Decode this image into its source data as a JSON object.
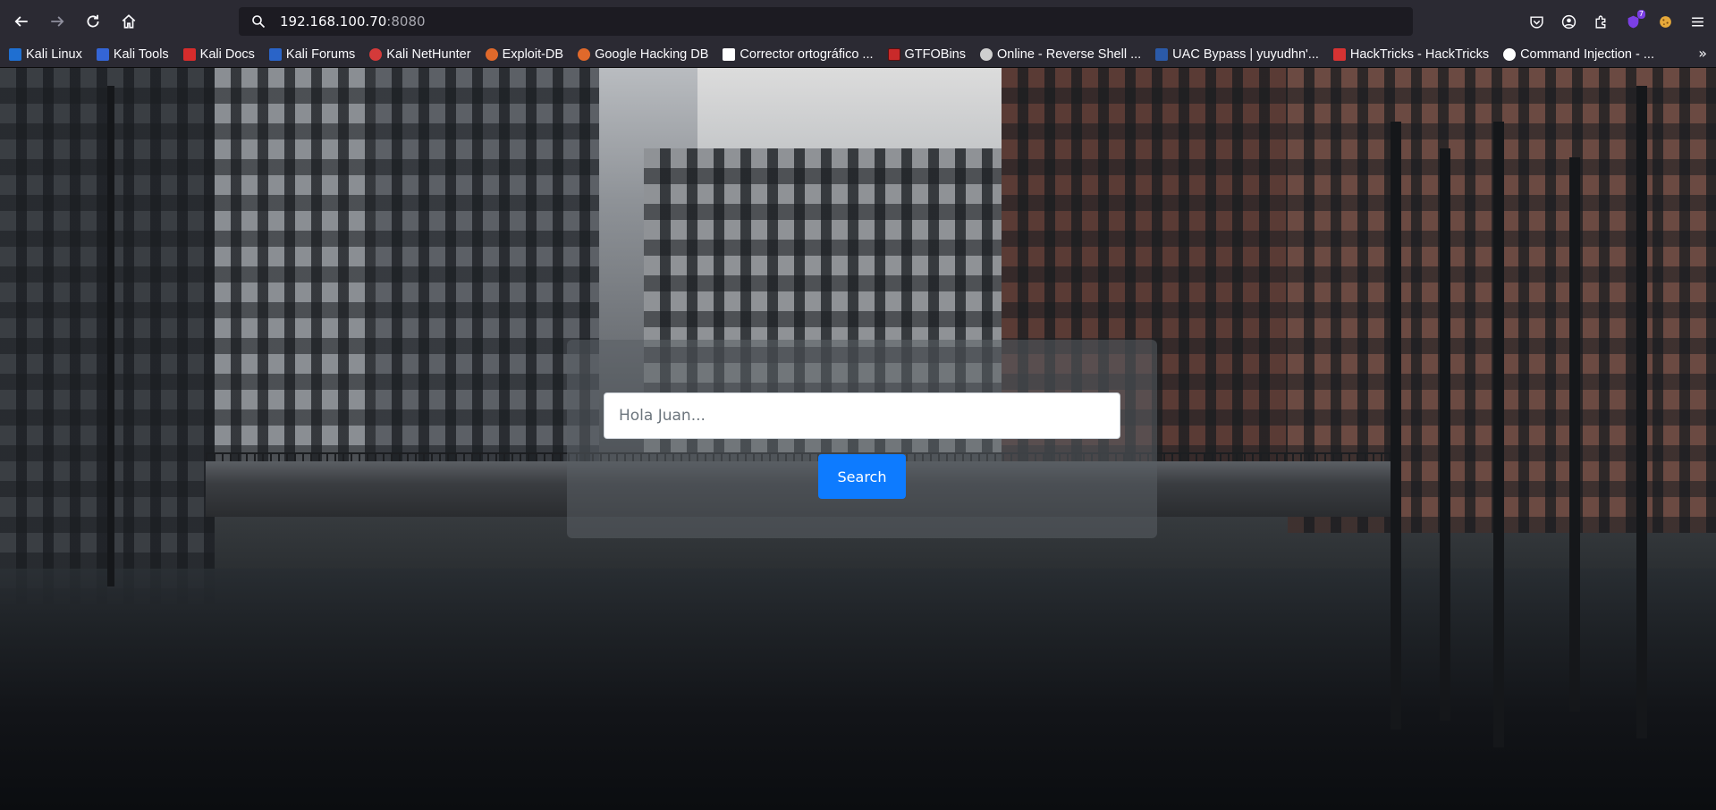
{
  "browser": {
    "url_host": "192.168.100.70",
    "url_port": ":8080",
    "extension_badge": "7"
  },
  "bookmarks": [
    {
      "label": "Kali Linux",
      "color": "#1f6fd1"
    },
    {
      "label": "Kali Tools",
      "color": "#3465d6"
    },
    {
      "label": "Kali Docs",
      "color": "#d62c2c"
    },
    {
      "label": "Kali Forums",
      "color": "#2a64c8"
    },
    {
      "label": "Kali NetHunter",
      "color": "#d43a3a"
    },
    {
      "label": "Exploit-DB",
      "color": "#e0692b"
    },
    {
      "label": "Google Hacking DB",
      "color": "#e0692b"
    },
    {
      "label": "Corrector ortográfico ...",
      "color": "#ffffff"
    },
    {
      "label": "GTFOBins",
      "color": "#c92a2a"
    },
    {
      "label": "Online - Reverse Shell ...",
      "color": "#cfcfcf"
    },
    {
      "label": "UAC Bypass | yuyudhn'...",
      "color": "#2b5aa8"
    },
    {
      "label": "HackTricks - HackTricks",
      "color": "#d63333"
    },
    {
      "label": "Command Injection - ...",
      "color": "#ffffff"
    }
  ],
  "page": {
    "search_placeholder": "Hola Juan...",
    "search_button": "Search",
    "button_color": "#0d7bff"
  }
}
